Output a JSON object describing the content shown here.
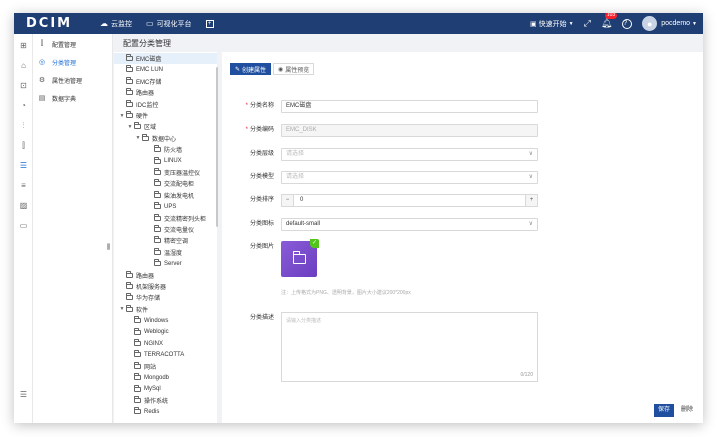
{
  "app": {
    "logo": "DCIM",
    "nav": [
      {
        "label": "云监控",
        "icon": "cloud-icon"
      },
      {
        "label": "可视化平台",
        "icon": "monitor-icon"
      }
    ],
    "nav_extra_icon": "add-tab-icon",
    "quick_start": "快速开始",
    "notification_count": "103",
    "username": "pocdemo"
  },
  "module_menu": [
    {
      "label": "配置管理",
      "icon": "sliders-icon",
      "active": false
    },
    {
      "label": "分类管理",
      "icon": "category-icon",
      "active": true
    },
    {
      "label": "属性池管理",
      "icon": "gear-icon",
      "active": false
    },
    {
      "label": "数据字典",
      "icon": "book-icon",
      "active": false
    }
  ],
  "page_title": "配置分类管理",
  "tree": [
    {
      "label": "EMC磁盘",
      "level": 0,
      "arrow": false,
      "selected": true
    },
    {
      "label": "EMC LUN",
      "level": 0,
      "arrow": false
    },
    {
      "label": "EMC存储",
      "level": 0,
      "arrow": false
    },
    {
      "label": "路由器",
      "level": 0,
      "arrow": false
    },
    {
      "label": "IDC监控",
      "level": 0,
      "arrow": false
    },
    {
      "label": "硬件",
      "level": 0,
      "arrow": true
    },
    {
      "label": "区域",
      "level": 1,
      "arrow": true
    },
    {
      "label": "数据中心",
      "level": 2,
      "arrow": true
    },
    {
      "label": "防火墙",
      "level": 3,
      "arrow": false
    },
    {
      "label": "LINUX",
      "level": 3,
      "arrow": false
    },
    {
      "label": "变压器温控仪",
      "level": 3,
      "arrow": false
    },
    {
      "label": "交流配电柜",
      "level": 3,
      "arrow": false
    },
    {
      "label": "柴油发电机",
      "level": 3,
      "arrow": false
    },
    {
      "label": "UPS",
      "level": 3,
      "arrow": false
    },
    {
      "label": "交流精密列头柜",
      "level": 3,
      "arrow": false
    },
    {
      "label": "交流电量仪",
      "level": 3,
      "arrow": false
    },
    {
      "label": "精密空调",
      "level": 3,
      "arrow": false
    },
    {
      "label": "温湿度",
      "level": 3,
      "arrow": false
    },
    {
      "label": "Server",
      "level": 3,
      "arrow": false
    },
    {
      "label": "路由器",
      "level": 0,
      "arrow": false
    },
    {
      "label": "机架服务器",
      "level": 0,
      "arrow": false
    },
    {
      "label": "华为存储",
      "level": 0,
      "arrow": false
    },
    {
      "label": "软件",
      "level": 0,
      "arrow": true
    },
    {
      "label": "Windows",
      "level": 1,
      "arrow": false
    },
    {
      "label": "Weblogic",
      "level": 1,
      "arrow": false
    },
    {
      "label": "NGINX",
      "level": 1,
      "arrow": false
    },
    {
      "label": "TERRACOTTA",
      "level": 1,
      "arrow": false
    },
    {
      "label": "网站",
      "level": 1,
      "arrow": false
    },
    {
      "label": "Mongodb",
      "level": 1,
      "arrow": false
    },
    {
      "label": "MySql",
      "level": 1,
      "arrow": false
    },
    {
      "label": "操作系统",
      "level": 1,
      "arrow": false
    },
    {
      "label": "Redis",
      "level": 1,
      "arrow": false
    }
  ],
  "tabs": [
    {
      "label": "创建属性",
      "active": true
    },
    {
      "label": "属性预览",
      "active": false
    }
  ],
  "form": {
    "name": {
      "label": "分类名称",
      "value": "EMC磁盘"
    },
    "code": {
      "label": "分类编码",
      "value": "EMC_DISK"
    },
    "group": {
      "label": "分类层级",
      "placeholder": "请选择"
    },
    "model": {
      "label": "分类模型",
      "placeholder": "请选择"
    },
    "order": {
      "label": "分类排序",
      "value": "0",
      "minus": "−",
      "plus": "+"
    },
    "icon": {
      "label": "分类图标",
      "value": "default-small"
    },
    "image": {
      "label": "分类图片",
      "hint": "注：上传格式为PNG、透明背景，图片大小建议200*200px"
    },
    "desc": {
      "label": "分类描述",
      "placeholder": "请输入分类描述",
      "count": "0/120"
    }
  },
  "buttons": {
    "save": "保存",
    "delete": "删除"
  }
}
